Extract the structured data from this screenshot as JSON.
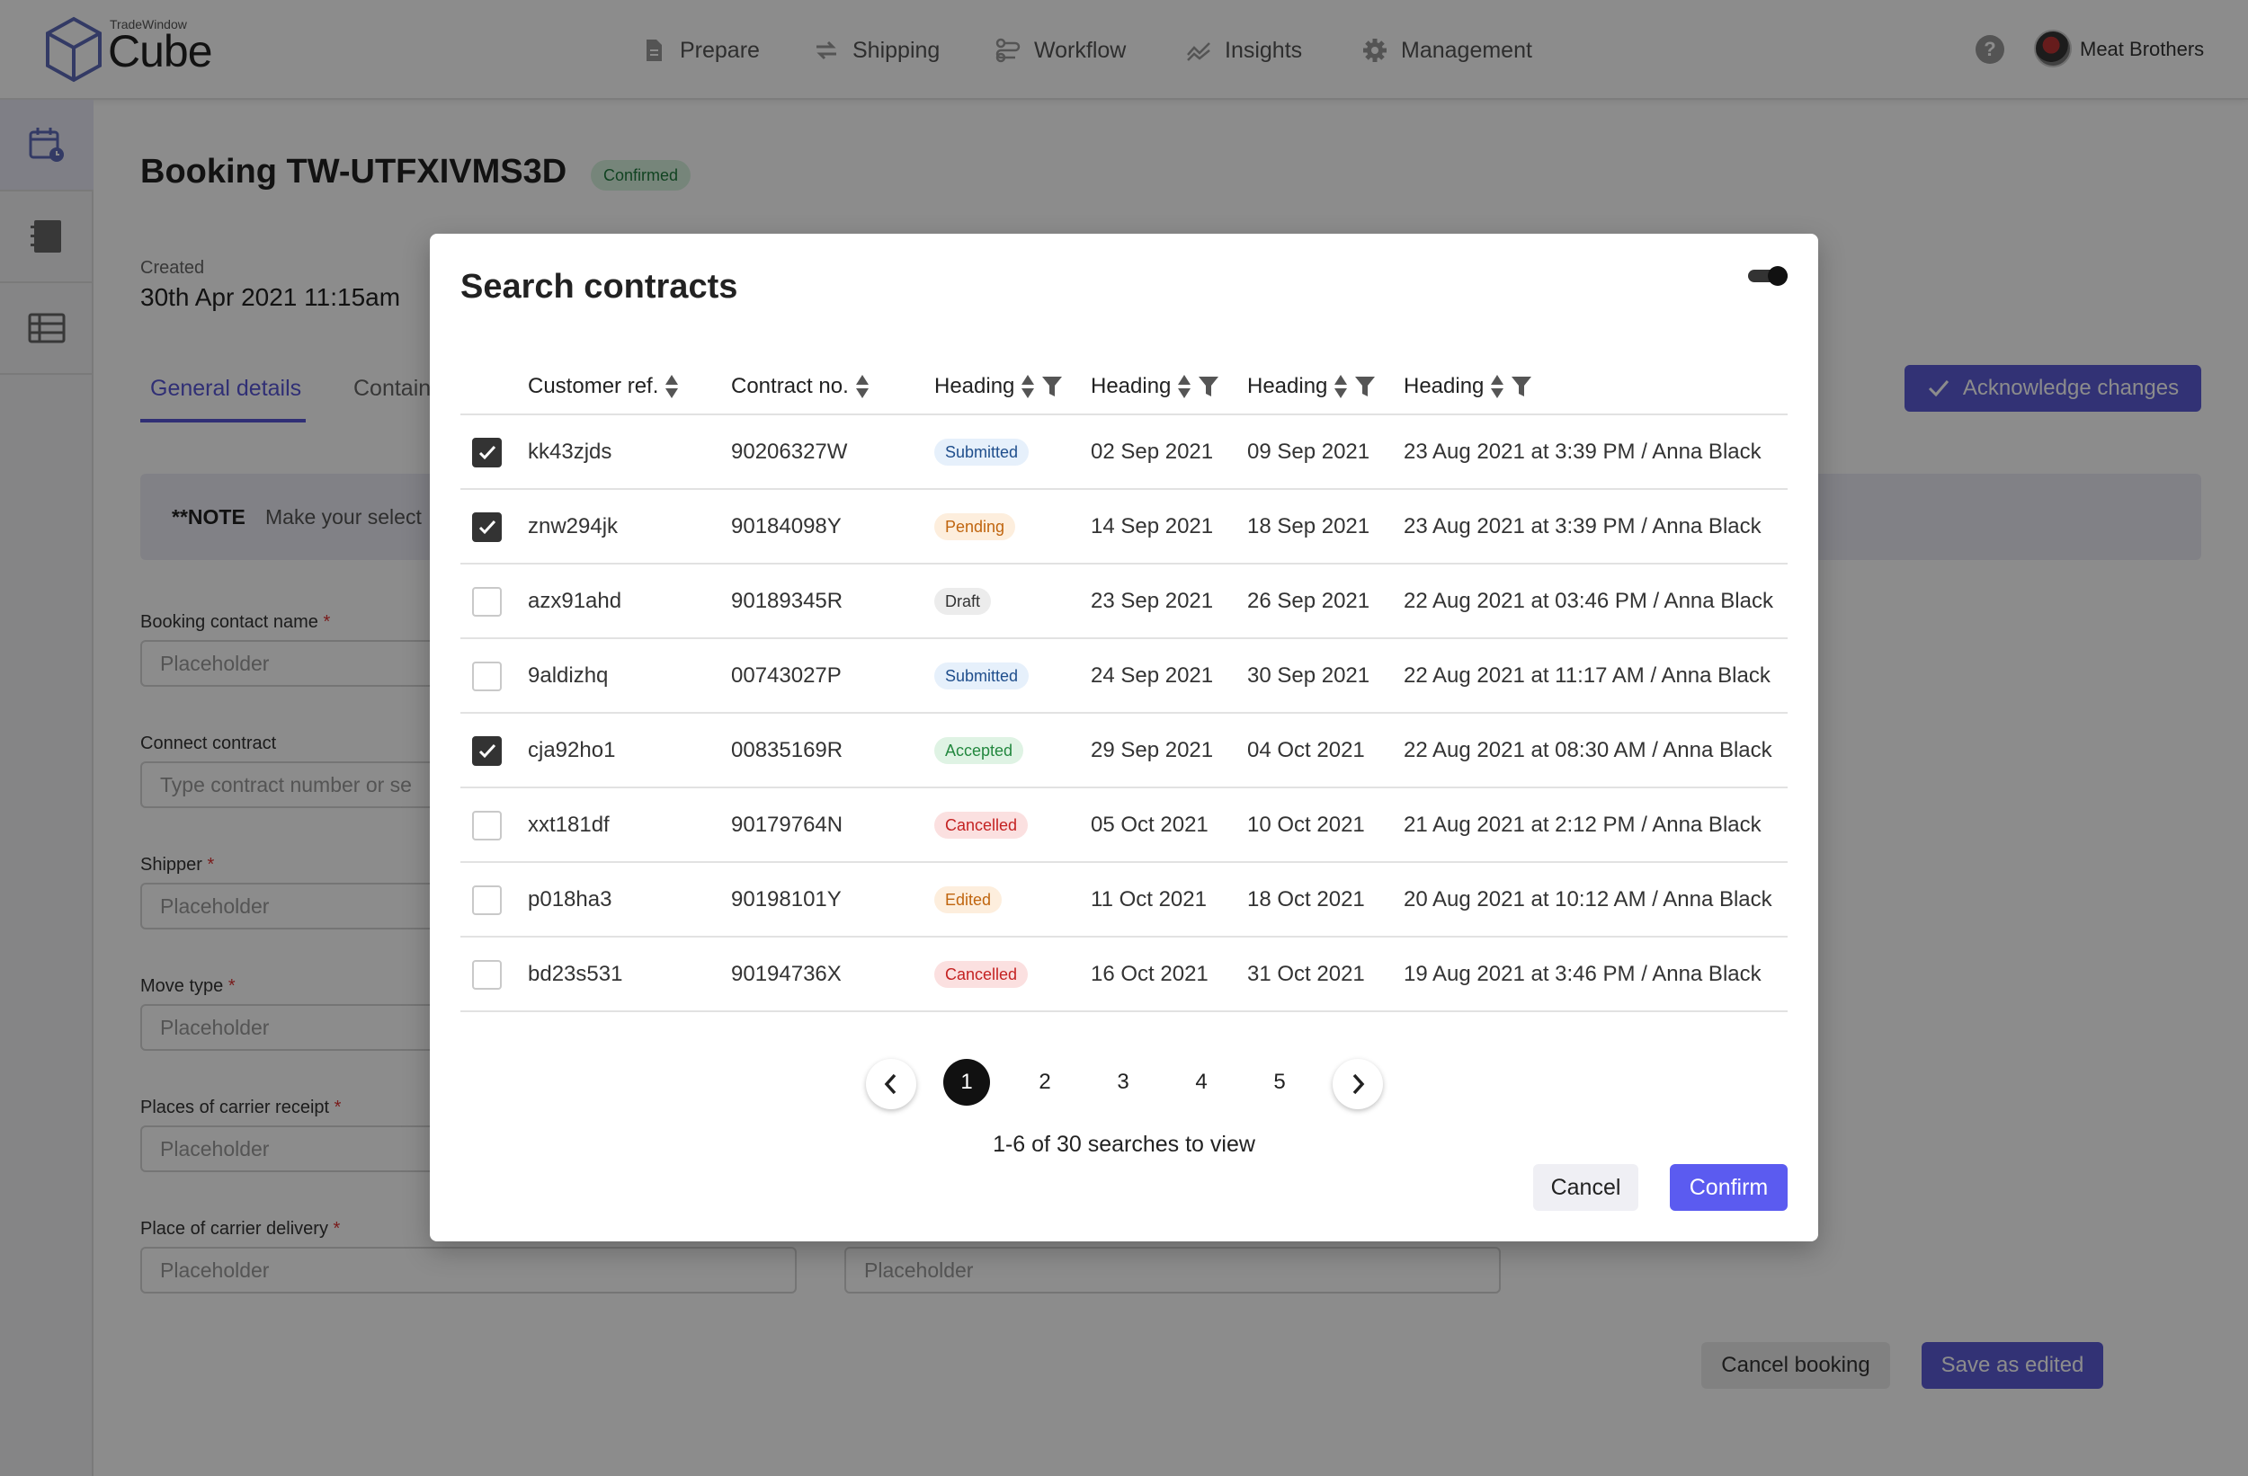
{
  "app": {
    "logo_small": "TradeWindow",
    "logo_big": "Cube"
  },
  "nav": {
    "items": [
      {
        "label": "Prepare",
        "icon": "document-icon"
      },
      {
        "label": "Shipping",
        "icon": "arrows-swap-icon"
      },
      {
        "label": "Workflow",
        "icon": "workflow-icon"
      },
      {
        "label": "Insights",
        "icon": "chart-line-icon"
      },
      {
        "label": "Management",
        "icon": "gear-icon"
      }
    ],
    "help_glyph": "?",
    "user_name": "Meat Brothers"
  },
  "page": {
    "title": "Booking TW-UTFXIVMS3D",
    "status": "Confirmed",
    "created_label": "Created",
    "created_value": "30th Apr 2021 11:15am",
    "tabs": [
      "General details",
      "Contain"
    ],
    "ack_button": "Acknowledge changes",
    "note_title": "**NOTE",
    "note_text": "Make your select",
    "fields": [
      {
        "label": "Booking contact name",
        "required": "*",
        "placeholder": "Placeholder"
      },
      {
        "label": "Connect contract",
        "required": "",
        "placeholder": "Type contract number or se"
      },
      {
        "label": "Shipper",
        "required": "*",
        "placeholder": "Placeholder"
      },
      {
        "label": "Move type",
        "required": "*",
        "placeholder": "Placeholder"
      },
      {
        "label": "Places of carrier receipt",
        "required": "*",
        "placeholder": "Placeholder"
      },
      {
        "label": "Place of carrier delivery",
        "required": "*",
        "placeholder": "Placeholder"
      }
    ],
    "extra_placeholder": "Placeholder",
    "cancel_booking": "Cancel booking",
    "save_edited": "Save as edited"
  },
  "modal": {
    "title": "Search contracts",
    "toggle_on": true,
    "columns": [
      "Customer ref.",
      "Contract no.",
      "Heading",
      "Heading",
      "Heading",
      "Heading"
    ],
    "rows": [
      {
        "checked": true,
        "ref": "kk43zjds",
        "contract": "90206327W",
        "status": "Submitted",
        "date1": "02 Sep 2021",
        "date2": "09 Sep 2021",
        "updated": "23 Aug 2021 at 3:39 PM / Anna Black"
      },
      {
        "checked": true,
        "ref": "znw294jk",
        "contract": "90184098Y",
        "status": "Pending",
        "date1": "14 Sep 2021",
        "date2": "18 Sep 2021",
        "updated": "23 Aug 2021 at 3:39 PM / Anna Black"
      },
      {
        "checked": false,
        "ref": "azx91ahd",
        "contract": "90189345R",
        "status": "Draft",
        "date1": "23 Sep 2021",
        "date2": "26 Sep 2021",
        "updated": "22 Aug 2021 at 03:46 PM / Anna Black"
      },
      {
        "checked": false,
        "ref": "9aldizhq",
        "contract": "00743027P",
        "status": "Submitted",
        "date1": "24 Sep 2021",
        "date2": "30 Sep 2021",
        "updated": "22 Aug 2021 at 11:17 AM / Anna Black"
      },
      {
        "checked": true,
        "ref": "cja92ho1",
        "contract": "00835169R",
        "status": "Accepted",
        "date1": "29 Sep 2021",
        "date2": "04 Oct 2021",
        "updated": "22 Aug 2021 at 08:30 AM / Anna Black"
      },
      {
        "checked": false,
        "ref": "xxt181df",
        "contract": "90179764N",
        "status": "Cancelled",
        "date1": "05 Oct 2021",
        "date2": "10 Oct 2021",
        "updated": "21 Aug 2021 at 2:12 PM / Anna Black"
      },
      {
        "checked": false,
        "ref": "p018ha3",
        "contract": "90198101Y",
        "status": "Edited",
        "date1": "11 Oct 2021",
        "date2": "18 Oct 2021",
        "updated": "20 Aug 2021 at 10:12 AM / Anna Black"
      },
      {
        "checked": false,
        "ref": "bd23s531",
        "contract": "90194736X",
        "status": "Cancelled",
        "date1": "16 Oct 2021",
        "date2": "31 Oct 2021",
        "updated": "19 Aug 2021 at 3:46 PM / Anna Black"
      }
    ],
    "status_colors": {
      "Submitted": {
        "bg": "#e6f0fb",
        "fg": "#1f4e8c"
      },
      "Pending": {
        "bg": "#fdeedd",
        "fg": "#c0650f"
      },
      "Draft": {
        "bg": "#ececec",
        "fg": "#333333"
      },
      "Accepted": {
        "bg": "#dff3e4",
        "fg": "#23883f"
      },
      "Cancelled": {
        "bg": "#fbe0e0",
        "fg": "#c42222"
      },
      "Edited": {
        "bg": "#fdeedd",
        "fg": "#c0650f"
      }
    },
    "pagination": {
      "pages": [
        "1",
        "2",
        "3",
        "4",
        "5"
      ],
      "current": "1",
      "summary": "1-6 of 30 searches to view"
    },
    "cancel": "Cancel",
    "confirm": "Confirm"
  },
  "colors": {
    "accent": "#5b5bd6",
    "confirm": "#5b5bf0"
  }
}
